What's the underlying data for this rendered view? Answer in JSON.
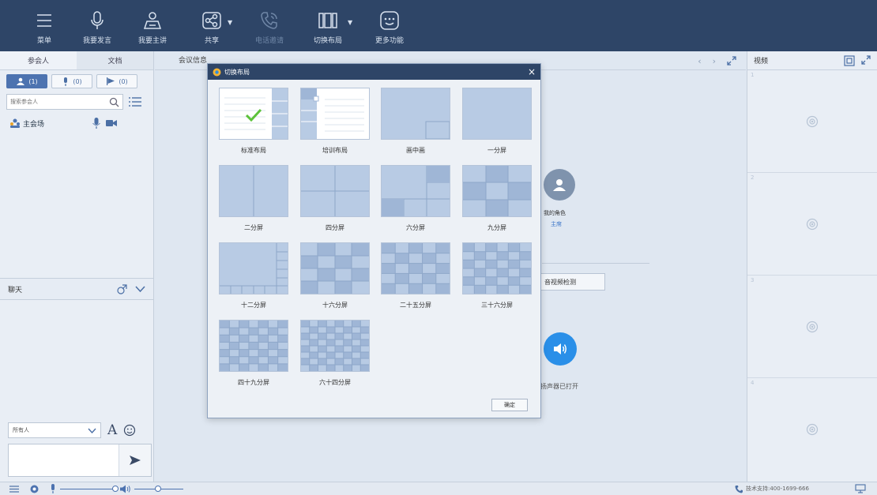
{
  "toolbar": {
    "items": [
      {
        "label": "菜单",
        "icon": "menu-icon"
      },
      {
        "label": "我要发言",
        "icon": "microphone-icon"
      },
      {
        "label": "我要主讲",
        "icon": "presenter-icon"
      },
      {
        "label": "共享",
        "icon": "share-icon"
      },
      {
        "label": "电话邀请",
        "icon": "phone-icon"
      },
      {
        "label": "切换布局",
        "icon": "layout-icon"
      },
      {
        "label": "更多功能",
        "icon": "more-icon"
      }
    ]
  },
  "left_panel": {
    "tabs": [
      "参会人",
      "文档"
    ],
    "filters": [
      "(1)",
      "(0)",
      "(0)"
    ],
    "search_placeholder": "搜索参会人",
    "participant": "主会场",
    "chat_title": "聊天",
    "recipient": "所有人"
  },
  "center": {
    "tab": "会议信息",
    "role_name": "我的角色",
    "role_value": "主席",
    "av_check_button": "音视频检测",
    "speaker_status": "扬声器已打开"
  },
  "right_panel": {
    "title": "视频",
    "cell_numbers": [
      "1",
      "2",
      "3",
      "4"
    ]
  },
  "status_bar": {
    "support": "技术支持:400-1699-666"
  },
  "dialog": {
    "title": "切换布局",
    "close": "×",
    "options": [
      "标准布局",
      "培训布局",
      "画中画",
      "一分屏",
      "二分屏",
      "四分屏",
      "六分屏",
      "九分屏",
      "十二分屏",
      "十六分屏",
      "二十五分屏",
      "三十六分屏",
      "四十九分屏",
      "六十四分屏"
    ],
    "selected": "标准布局",
    "ok_button": "确定"
  },
  "colors": {
    "toolbar_bg": "#2e4567",
    "accent": "#4d73b0",
    "thumb_fill": "#b8cbe4",
    "speaker_blue": "#2a8fe8"
  }
}
